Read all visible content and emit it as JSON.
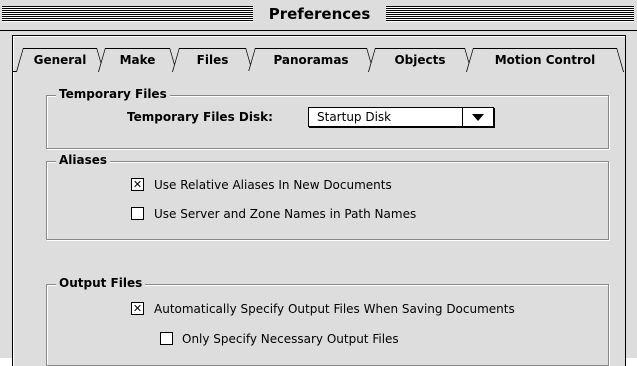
{
  "window": {
    "title": "Preferences"
  },
  "tabs": [
    {
      "label": "General",
      "active": false
    },
    {
      "label": "Make",
      "active": false
    },
    {
      "label": "Files",
      "active": true
    },
    {
      "label": "Panoramas",
      "active": false
    },
    {
      "label": "Objects",
      "active": false
    },
    {
      "label": "Motion Control",
      "active": false
    }
  ],
  "temporary_files": {
    "title": "Temporary Files",
    "disk_label": "Temporary Files Disk:",
    "disk_value": "Startup Disk"
  },
  "aliases": {
    "title": "Aliases",
    "relative": {
      "label": "Use Relative Aliases In New Documents",
      "checked": true,
      "mark": "✕"
    },
    "server_zone": {
      "label": "Use Server and Zone Names in Path Names",
      "checked": false,
      "mark": ""
    }
  },
  "output_files": {
    "title": "Output Files",
    "auto_specify": {
      "label": "Automatically Specify Output Files When Saving Documents",
      "checked": true,
      "mark": "✕"
    },
    "only_necessary": {
      "label": "Only Specify Necessary Output Files",
      "checked": false,
      "mark": ""
    }
  }
}
